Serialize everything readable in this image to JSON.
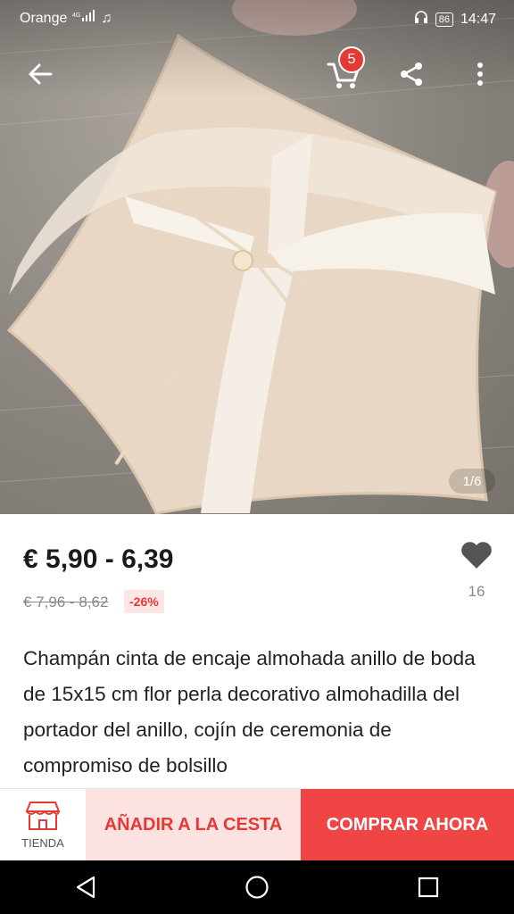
{
  "status_bar": {
    "carrier": "Orange",
    "network_icon": "signal-4g-icon",
    "music_icon": "music-note-icon",
    "headset_icon": "headphones-icon",
    "battery": "86",
    "time": "14:47"
  },
  "top_bar": {
    "back_icon": "back-arrow-icon",
    "cart_icon": "cart-icon",
    "cart_count": "5",
    "share_icon": "share-icon",
    "more_icon": "more-vertical-icon"
  },
  "gallery": {
    "counter": "1/6"
  },
  "product": {
    "price": "€ 5,90 - 6,39",
    "old_price": "€ 7,96 - 8,62",
    "discount": "-26%",
    "wishlist_count": "16",
    "title": "Champán cinta de encaje almohada anillo de boda de 15x15 cm flor perla decorativo almohadilla del portador del anillo, cojín de ceremonia de compromiso de bolsillo"
  },
  "bottom_bar": {
    "store_label": "TIENDA",
    "add_to_cart": "AÑADIR A LA CESTA",
    "buy_now": "COMPRAR AHORA"
  },
  "colors": {
    "accent": "#f04545",
    "accent_light": "#fde2e2",
    "badge": "#e53935"
  }
}
